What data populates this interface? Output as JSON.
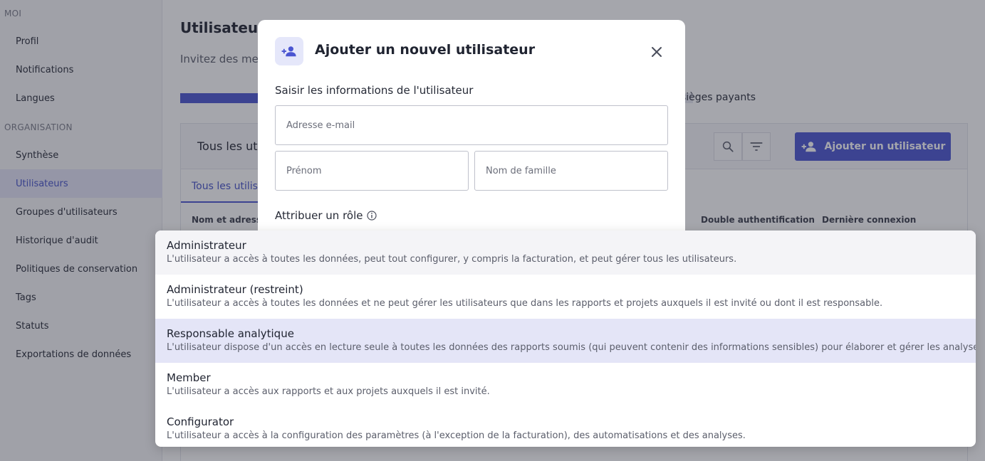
{
  "sidebar": {
    "section_me": "MOI",
    "me_items": [
      {
        "label": "Profil"
      },
      {
        "label": "Notifications"
      },
      {
        "label": "Langues"
      }
    ],
    "section_org": "ORGANISATION",
    "org_items": [
      {
        "label": "Synthèse"
      },
      {
        "label": "Utilisateurs",
        "active": true
      },
      {
        "label": "Groupes d'utilisateurs"
      },
      {
        "label": "Historique d'audit"
      },
      {
        "label": "Politiques de conservation"
      },
      {
        "label": "Tags"
      },
      {
        "label": "Statuts"
      },
      {
        "label": "Exportations de données"
      }
    ]
  },
  "main": {
    "title": "Utilisateurs",
    "subtitle": "Invitez des mem",
    "seats_text": "sièges payants",
    "seats_progress_fraction": 0.2,
    "panel_title": "Tous les util",
    "add_user_label": "Ajouter un utilisateur",
    "tab_label": "Tous les utilisa",
    "columns": [
      "Nom et adresse e",
      "Double authentification",
      "Dernière connexion"
    ]
  },
  "modal": {
    "title": "Ajouter un nouvel utilisateur",
    "info_section": "Saisir les informations de l'utilisateur",
    "email_placeholder": "Adresse e-mail",
    "first_name_placeholder": "Prénom",
    "last_name_placeholder": "Nom de famille",
    "role_section": "Attribuer un rôle"
  },
  "roles": [
    {
      "label": "Administrateur",
      "description": "L'utilisateur a accès à toutes les données, peut tout configurer, y compris la facturation, et peut gérer tous les utilisateurs.",
      "state": "hover"
    },
    {
      "label": "Administrateur (restreint)",
      "description": "L'utilisateur a accès à toutes les données et ne peut gérer les utilisateurs que dans les rapports et projets auxquels il est invité ou dont il est responsable.",
      "state": "normal"
    },
    {
      "label": "Responsable analytique",
      "description": "L'utilisateur dispose d'un accès en lecture seule à toutes les données des rapports soumis (qui peuvent contenir des informations sensibles) pour élaborer et gérer les analyses.",
      "state": "selected"
    },
    {
      "label": "Member",
      "description": "L'utilisateur a accès aux rapports et aux projets auxquels il est invité.",
      "state": "normal"
    },
    {
      "label": "Configurator",
      "description": "L'utilisateur a accès à la configuration des paramètres (à l'exception de la facturation), des automatisations et des analyses.",
      "state": "normal"
    }
  ],
  "colors": {
    "accent": "#4a55d1",
    "selected_bg": "#e4e5f7",
    "hover_bg": "#f4f4f7"
  },
  "icons": [
    "add-user-icon",
    "close-icon",
    "info-icon",
    "search-icon",
    "filter-icon"
  ]
}
